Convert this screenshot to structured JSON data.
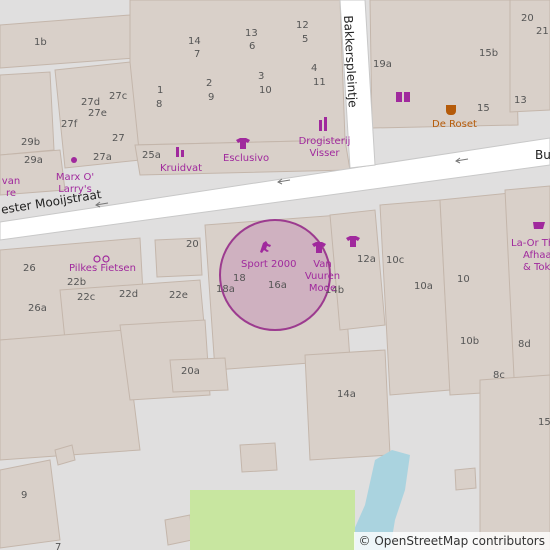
{
  "streets": {
    "mooijstraat": "ester Mooijstraat",
    "bakkerspleintje": "Bakkerspleintje",
    "east": "Bu"
  },
  "house_numbers": [
    "1b",
    "14",
    "7",
    "13",
    "6",
    "12",
    "5",
    "19a",
    "15b",
    "20",
    "21",
    "2",
    "3",
    "4",
    "9",
    "10",
    "11",
    "1",
    "8",
    "27d",
    "27c",
    "27e",
    "27f",
    "27",
    "27a",
    "29b",
    "29a",
    "25a",
    "13",
    "15",
    "26",
    "22b",
    "22c",
    "22d",
    "22e",
    "26a",
    "20",
    "18",
    "16a",
    "12a",
    "10c",
    "10a",
    "10",
    "18a",
    "14b",
    "10b",
    "8d",
    "8c",
    "20a",
    "14a",
    "9",
    "15",
    "7"
  ],
  "pois": {
    "marx": "Marx O' Larry's",
    "kruidvat": "Kruidvat",
    "esclusivo": "Esclusivo",
    "drogisterij": "Drogisterij Visser",
    "roset": "De Roset",
    "pilkes": "Pilkes Fietsen",
    "sport2000": "Sport 2000",
    "vanvuuren": "Van Vuuren Mode",
    "laorth": "La-Or Th",
    "afhaal": "Afhaal",
    "tok": "& Tok",
    "vanre": "van re"
  },
  "attribution": "© OpenStreetMap contributors",
  "colors": {
    "building": "#d9d0c9",
    "road": "#ffffff",
    "highlight": "#a0299d",
    "water": "#aad3df",
    "grass": "#c8e6a0"
  }
}
